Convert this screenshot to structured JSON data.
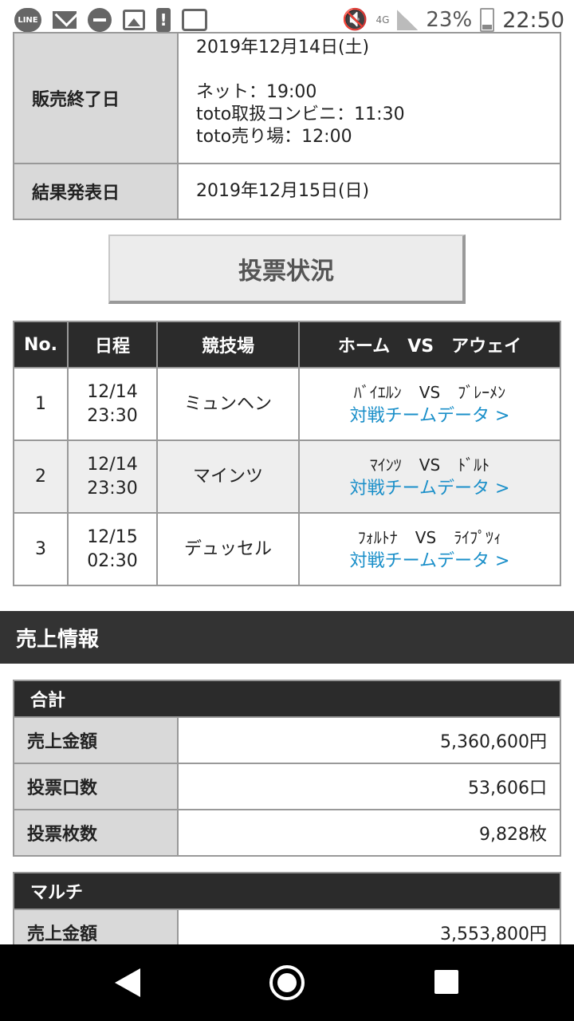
{
  "status_bar": {
    "line_label": "LINE",
    "network": "4G",
    "battery": "23%",
    "time": "22:50"
  },
  "schedule": {
    "date_top": "2019年12月14日(土)",
    "sales_end_label": "販売終了日",
    "net_time": "ネット：19:00",
    "conv_time": "toto取扱コンビニ：11:30",
    "shop_time": "toto売り場：12:00",
    "result_label": "結果発表日",
    "result_date": "2019年12月15日(日)"
  },
  "vote_button": "投票状況",
  "match_table": {
    "headers": [
      "No.",
      "日程",
      "競技場",
      "ホーム　VS　アウェイ"
    ],
    "link_text": "対戦チームデータ >",
    "vs": "VS",
    "rows": [
      {
        "no": "1",
        "date": "12/14",
        "time": "23:30",
        "venue": "ミュンヘン",
        "home": "ﾊﾞｲｴﾙﾝ",
        "away": "ﾌﾞﾚｰﾒﾝ"
      },
      {
        "no": "2",
        "date": "12/14",
        "time": "23:30",
        "venue": "マインツ",
        "home": "ﾏｲﾝﾂ",
        "away": "ﾄﾞﾙﾄ"
      },
      {
        "no": "3",
        "date": "12/15",
        "time": "02:30",
        "venue": "デュッセル",
        "home": "ﾌｫﾙﾄﾅ",
        "away": "ﾗｲﾌﾟﾂｨ"
      }
    ]
  },
  "sales_section_title": "売上情報",
  "sales_total": {
    "title": "合計",
    "rows": [
      {
        "label": "売上金額",
        "value": "5,360,600円"
      },
      {
        "label": "投票口数",
        "value": "53,606口"
      },
      {
        "label": "投票枚数",
        "value": "9,828枚"
      }
    ]
  },
  "sales_multi": {
    "title": "マルチ",
    "rows": [
      {
        "label": "売上金額",
        "value": "3,553,800円"
      }
    ]
  }
}
